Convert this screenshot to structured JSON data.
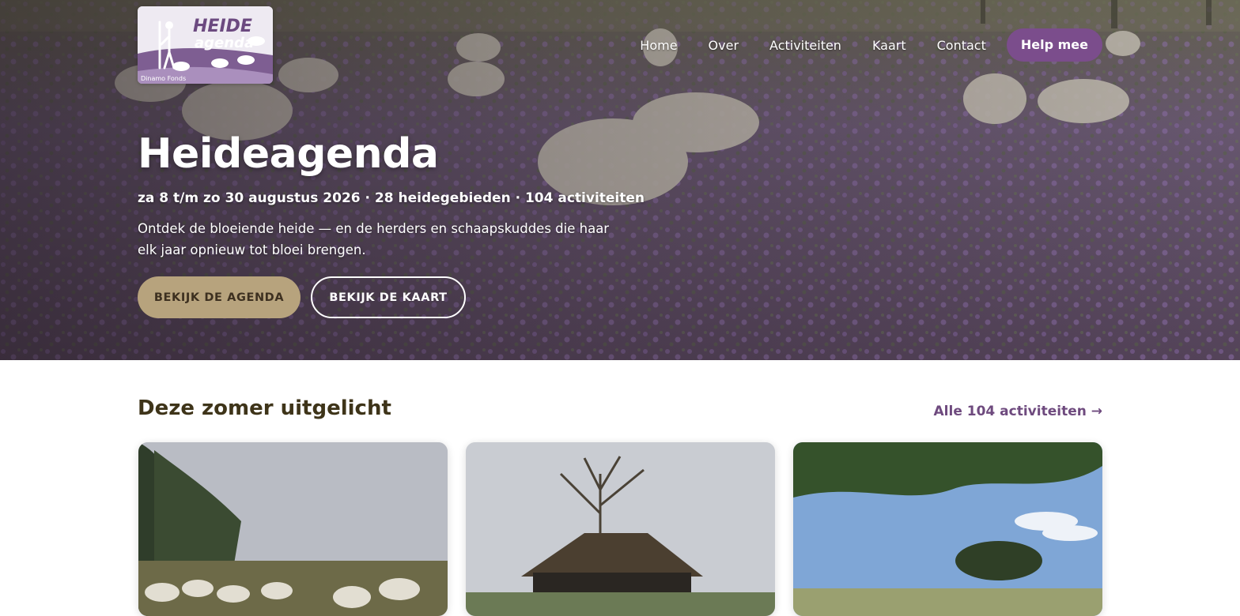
{
  "logo": {
    "line1": "HEIDE",
    "line2": "agenda",
    "sponsor": "Dinamo Fonds"
  },
  "nav": {
    "items": [
      {
        "label": "Home"
      },
      {
        "label": "Over"
      },
      {
        "label": "Activiteiten"
      },
      {
        "label": "Kaart"
      },
      {
        "label": "Contact"
      }
    ],
    "cta_label": "Help mee"
  },
  "hero": {
    "title": "Heideagenda",
    "subtitle": "za 8 t/m zo 30 augustus 2026 · 28 heidegebieden · 104 activiteiten",
    "description": "Ontdek de bloeiende heide — en de herders en schaapskuddes die haar elk jaar opnieuw tot bloei brengen.",
    "primary_button": "BEKIJK DE AGENDA",
    "secondary_button": "BEKIJK DE KAART"
  },
  "featured": {
    "title": "Deze zomer uitgelicht",
    "all_link": "Alle 104 activiteiten →"
  },
  "colors": {
    "brand_purple": "#7b4d8c",
    "accent_sand": "#b7a37d",
    "title_brown": "#3e3419",
    "heather": "#8a6aa4"
  }
}
